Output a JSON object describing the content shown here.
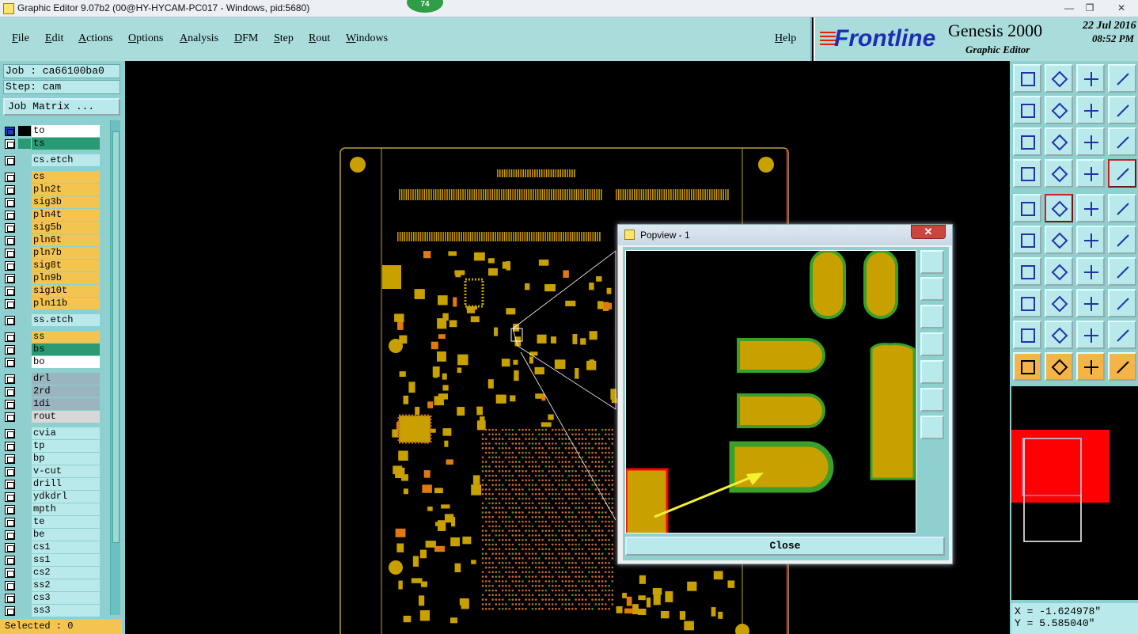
{
  "window": {
    "title": "Graphic Editor 9.07b2 (00@HY-HYCAM-PC017 - Windows, pid:5680)",
    "badge": "74",
    "min": "—",
    "max": "❐",
    "close": "✕"
  },
  "menu": [
    {
      "label": "File"
    },
    {
      "label": "Edit"
    },
    {
      "label": "Actions"
    },
    {
      "label": "Options"
    },
    {
      "label": "Analysis"
    },
    {
      "label": "DFM"
    },
    {
      "label": "Step"
    },
    {
      "label": "Rout"
    },
    {
      "label": "Windows"
    }
  ],
  "help": "Help",
  "brand": {
    "logo": "Frontline",
    "product": "Genesis 2000",
    "subtitle": "Graphic Editor",
    "date": "22 Jul 2016",
    "time": "08:52 PM"
  },
  "job": {
    "job": "Job : ca66100ba0",
    "step": "Step: cam",
    "matrix": "Job Matrix ..."
  },
  "layers": [
    {
      "name": "to",
      "bg": "#ffffff",
      "sw": "#000000",
      "sel": true
    },
    {
      "name": "ts",
      "bg": "#2a9a72",
      "sw": "#2a9a72"
    },
    {
      "name": "cs.etch",
      "bg": "#b9e9ea",
      "sw": "#8ecfcf",
      "gap": true
    },
    {
      "name": "cs",
      "bg": "#f4c450",
      "sw": "#8ecfcf",
      "gap": true
    },
    {
      "name": "pln2t",
      "bg": "#f4c450",
      "sw": "#8ecfcf"
    },
    {
      "name": "sig3b",
      "bg": "#f4c450",
      "sw": "#8ecfcf"
    },
    {
      "name": "pln4t",
      "bg": "#f4c450",
      "sw": "#8ecfcf"
    },
    {
      "name": "sig5b",
      "bg": "#f4c450",
      "sw": "#8ecfcf"
    },
    {
      "name": "pln6t",
      "bg": "#f4c450",
      "sw": "#8ecfcf"
    },
    {
      "name": "pln7b",
      "bg": "#f4c450",
      "sw": "#8ecfcf"
    },
    {
      "name": "sig8t",
      "bg": "#f4c450",
      "sw": "#8ecfcf"
    },
    {
      "name": "pln9b",
      "bg": "#f4c450",
      "sw": "#8ecfcf"
    },
    {
      "name": "sig10t",
      "bg": "#f4c450",
      "sw": "#8ecfcf"
    },
    {
      "name": "pln11b",
      "bg": "#f4c450",
      "sw": "#8ecfcf"
    },
    {
      "name": "ss.etch",
      "bg": "#b9e9ea",
      "sw": "#8ecfcf",
      "gap": true
    },
    {
      "name": "ss",
      "bg": "#f4c450",
      "sw": "#8ecfcf",
      "gap": true
    },
    {
      "name": "bs",
      "bg": "#2a9a72",
      "sw": "#8ecfcf"
    },
    {
      "name": "bo",
      "bg": "#ffffff",
      "sw": "#8ecfcf"
    },
    {
      "name": "drl",
      "bg": "#9ab4c0",
      "sw": "#8ecfcf",
      "gap": true
    },
    {
      "name": "2rd",
      "bg": "#9ab4c0",
      "sw": "#8ecfcf"
    },
    {
      "name": "1di",
      "bg": "#9ab4c0",
      "sw": "#8ecfcf"
    },
    {
      "name": "rout",
      "bg": "#d8d8d8",
      "sw": "#8ecfcf"
    },
    {
      "name": "cvia",
      "bg": "#b9e9ea",
      "sw": "#8ecfcf",
      "gap": true
    },
    {
      "name": "tp",
      "bg": "#b9e9ea",
      "sw": "#8ecfcf"
    },
    {
      "name": "bp",
      "bg": "#b9e9ea",
      "sw": "#8ecfcf"
    },
    {
      "name": "v-cut",
      "bg": "#b9e9ea",
      "sw": "#8ecfcf"
    },
    {
      "name": "drill",
      "bg": "#b9e9ea",
      "sw": "#8ecfcf"
    },
    {
      "name": "ydkdrl",
      "bg": "#b9e9ea",
      "sw": "#8ecfcf"
    },
    {
      "name": "mpth",
      "bg": "#b9e9ea",
      "sw": "#8ecfcf"
    },
    {
      "name": "te",
      "bg": "#b9e9ea",
      "sw": "#8ecfcf"
    },
    {
      "name": "be",
      "bg": "#b9e9ea",
      "sw": "#8ecfcf"
    },
    {
      "name": "cs1",
      "bg": "#b9e9ea",
      "sw": "#8ecfcf"
    },
    {
      "name": "ss1",
      "bg": "#b9e9ea",
      "sw": "#8ecfcf"
    },
    {
      "name": "cs2",
      "bg": "#b9e9ea",
      "sw": "#8ecfcf"
    },
    {
      "name": "ss2",
      "bg": "#b9e9ea",
      "sw": "#8ecfcf"
    },
    {
      "name": "cs3",
      "bg": "#b9e9ea",
      "sw": "#8ecfcf"
    },
    {
      "name": "ss3",
      "bg": "#b9e9ea",
      "sw": "#8ecfcf"
    }
  ],
  "selected": "Selected : 0",
  "coords": {
    "x": "X = -1.624978\"",
    "y": "Y = 5.585040\""
  },
  "popview": {
    "title": "Popview - 1",
    "close": "Close",
    "close_x": "✕"
  },
  "colors": {
    "pad": "#c8a000",
    "mask": "#3aa02a",
    "outline": "#e8d860",
    "red": "#ff0000"
  }
}
